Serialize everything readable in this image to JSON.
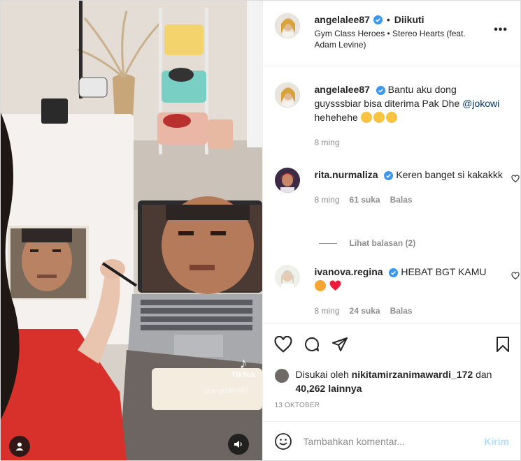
{
  "post": {
    "username": "angelalee87",
    "follow_state": "Diikuti",
    "separator": "•",
    "audio": "Gym Class Heroes • Stereo Hearts (feat. Adam Levine)",
    "more_label": "•••"
  },
  "media": {
    "watermark_brand": "TikTok",
    "watermark_handle": "@angelalee87",
    "icons": [
      "user-tag-icon",
      "sound-icon"
    ]
  },
  "caption": {
    "username": "angelalee87",
    "text_before_mention": "Bantu aku dong guysssbiar bisa diterima Pak Dhe ",
    "mention": "@jokowi",
    "text_after_mention": " hehehehe",
    "time": "8 ming"
  },
  "comments": [
    {
      "username": "rita.nurmaliza",
      "text": "Keren banget si kakakkk",
      "time": "8 ming",
      "likes": "61 suka",
      "reply_label": "Balas",
      "view_replies": "Lihat balasan (2)"
    },
    {
      "username": "ivanova.regina",
      "text": "HEBAT BGT KAMU",
      "time": "8 ming",
      "likes": "24 suka",
      "reply_label": "Balas"
    }
  ],
  "likes": {
    "prefix": "Disukai oleh",
    "user": "nikitamirzanimawardi_172",
    "connector": "dan",
    "count": "40,262 lainnya"
  },
  "date": "13 OKTOBER",
  "add_comment": {
    "placeholder": "Tambahkan komentar...",
    "post_label": "Kirim"
  },
  "colors": {
    "verified": "#3897f0",
    "link": "#00376b",
    "secondary_text": "#8e8e8e",
    "post_button_disabled": "#b2dffc",
    "heart_red": "#ed4956"
  }
}
